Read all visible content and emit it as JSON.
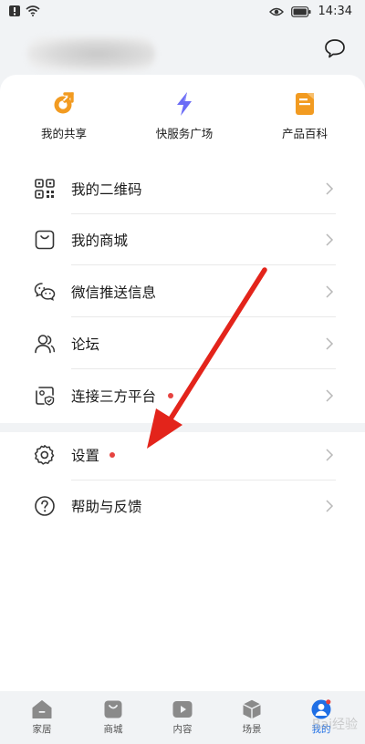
{
  "status_bar": {
    "time": "14:34"
  },
  "quick_actions": [
    {
      "label": "我的共享",
      "icon": "share-icon",
      "color": "#f29b21"
    },
    {
      "label": "快服务广场",
      "icon": "lightning-icon",
      "color": "#6b6cf6"
    },
    {
      "label": "产品百科",
      "icon": "book-icon",
      "color": "#f29b21"
    }
  ],
  "menu": {
    "qrcode": "我的二维码",
    "mall": "我的商城",
    "wechat": "微信推送信息",
    "forum": "论坛",
    "third_party": "连接三方平台",
    "settings": "设置",
    "help": "帮助与反馈"
  },
  "bottom_nav": [
    {
      "label": "家居",
      "icon": "home-icon"
    },
    {
      "label": "商城",
      "icon": "shopping-bag-icon"
    },
    {
      "label": "内容",
      "icon": "play-icon"
    },
    {
      "label": "场景",
      "icon": "cube-icon"
    },
    {
      "label": "我的",
      "icon": "user-avatar-icon",
      "active": true
    }
  ],
  "colors": {
    "accent": "#1f6fe5",
    "badge": "#e64340",
    "arrow": "#e3241b",
    "orange": "#f29b21",
    "purple": "#6b6cf6"
  }
}
